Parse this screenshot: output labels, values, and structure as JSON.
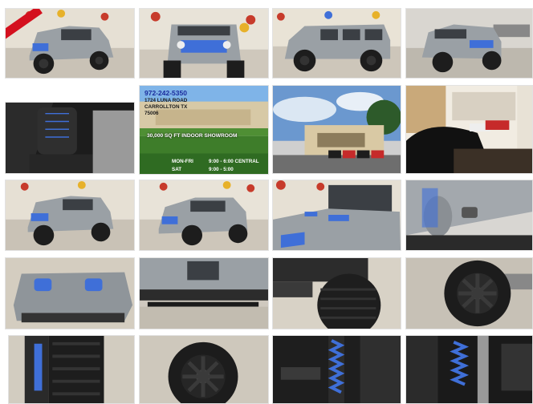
{
  "gallery": {
    "ribbon_label": "",
    "ad": {
      "phone": "972-242-5350",
      "address_line1": "1724 LUNA ROAD",
      "address_line2": "CARROLLTON TX",
      "address_line3": "75006",
      "showroom": "30,000 SQ FT INDOOR SHOWROOM",
      "hours_label_1": "MON-FRI",
      "hours_value_1": "9:00 - 6:00 CENTRAL",
      "hours_label_2": "SAT",
      "hours_value_2": "9:00 - 5:00"
    },
    "photos": [
      {
        "subject": "jeep-front-three-quarter"
      },
      {
        "subject": "jeep-front"
      },
      {
        "subject": "jeep-side"
      },
      {
        "subject": "jeep-rear-three-quarter"
      },
      {
        "subject": "front-seats"
      },
      {
        "subject": "dealership-ad"
      },
      {
        "subject": "dealership-exterior"
      },
      {
        "subject": "showroom-interior"
      },
      {
        "subject": "jeep-front-three-quarter-2"
      },
      {
        "subject": "jeep-front-three-quarter-3"
      },
      {
        "subject": "hood-and-windshield"
      },
      {
        "subject": "hood-latch"
      },
      {
        "subject": "hood-vents"
      },
      {
        "subject": "side-step"
      },
      {
        "subject": "front-tire"
      },
      {
        "subject": "black-wheel"
      },
      {
        "subject": "tire-tread"
      },
      {
        "subject": "wheel-closeup"
      },
      {
        "subject": "front-suspension"
      },
      {
        "subject": "shock-absorber"
      }
    ]
  },
  "colors": {
    "jeep_gray": "#9aa0a5",
    "accent_blue": "#3f6fd8",
    "dealer_red": "#c62a2a",
    "background": "#ffffff"
  }
}
